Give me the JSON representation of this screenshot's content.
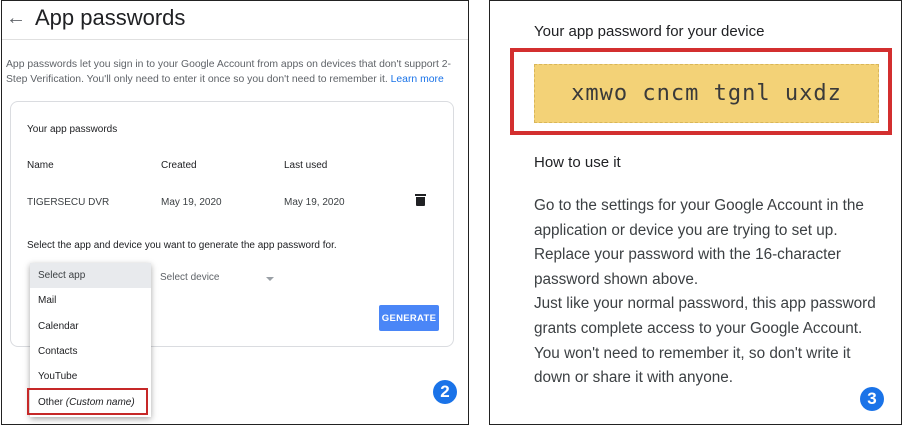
{
  "left": {
    "back_arrow": "←",
    "title": "App passwords",
    "description": "App passwords let you sign in to your Google Account from apps on devices that don't support 2-Step Verification. You'll only need to enter it once so you don't need to remember it.",
    "learn_more": "Learn more",
    "card_title": "Your app passwords",
    "columns": [
      "Name",
      "Created",
      "Last used"
    ],
    "row": {
      "name": "TIGERSECU DVR",
      "created": "May 19, 2020",
      "last_used": "May 19, 2020"
    },
    "select_label": "Select the app and device you want to generate the app password for.",
    "select_device": "Select device",
    "generate": "GENERATE",
    "dropdown": {
      "selected": "Select app",
      "items": [
        "Mail",
        "Calendar",
        "Contacts",
        "YouTube"
      ],
      "other": "Other",
      "other_hint": "(Custom name)"
    },
    "step": "2"
  },
  "right": {
    "title": "Your app password for your device",
    "password": "xmwo cncm tgnl uxdz",
    "how_title": "How to use it",
    "paragraph1": "Go to the settings for your Google Account in the application or device you are trying to set up. Replace your password with the 16-character password shown above.",
    "paragraph2": "Just like your normal password, this app password grants complete access to your Google Account. You won't need to remember it, so don't write it down or share it with anyone.",
    "step": "3"
  },
  "colors": {
    "accent": "#1a73e8",
    "button": "#4a86f7",
    "highlight": "#c62828",
    "password_bg": "#f3d277"
  }
}
